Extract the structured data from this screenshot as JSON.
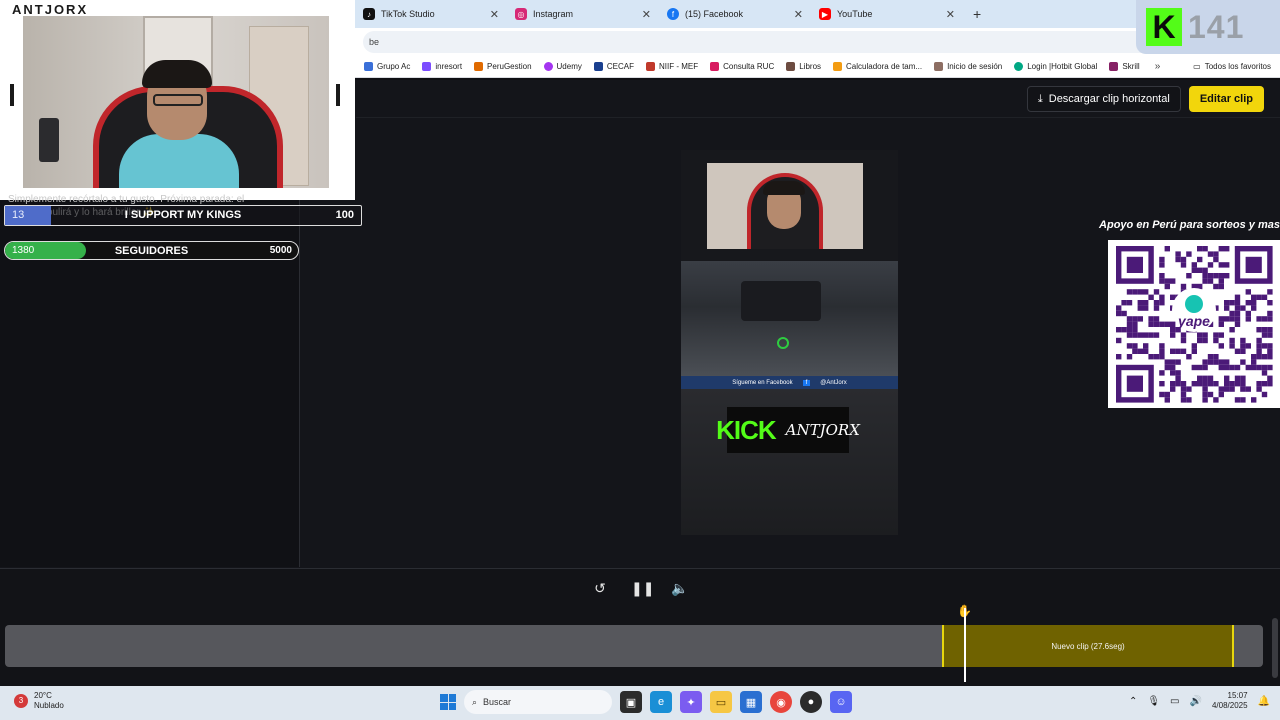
{
  "browser": {
    "tabs": [
      {
        "label": "TikTok Studio",
        "icon": "tiktok-icon",
        "color": "#111111"
      },
      {
        "label": "Instagram",
        "icon": "instagram-icon",
        "color": "#d62976"
      },
      {
        "label": "(15) Facebook",
        "icon": "facebook-icon",
        "color": "#1877f2"
      },
      {
        "label": "YouTube",
        "icon": "youtube-icon",
        "color": "#ff0000"
      }
    ],
    "address": "be",
    "bookmarks": [
      {
        "label": "Grupo Ac",
        "color": "#3a6fd8"
      },
      {
        "label": "inresort",
        "color": "#7c4dff"
      },
      {
        "label": "PeruGestion",
        "color": "#e06a00"
      },
      {
        "label": "Udemy",
        "color": "#a435f0"
      },
      {
        "label": "CECAF",
        "color": "#1a3f8f"
      },
      {
        "label": "NIIF - MEF",
        "color": "#c0392b"
      },
      {
        "label": "Consulta RUC",
        "color": "#d81b60"
      },
      {
        "label": "Libros",
        "color": "#6d4c41"
      },
      {
        "label": "Calculadora de tam...",
        "color": "#f39c12"
      },
      {
        "label": "Inicio de sesión",
        "color": "#8d6e63"
      },
      {
        "label": "Login |Hotbit Global",
        "color": "#00a884"
      },
      {
        "label": "Skrill",
        "color": "#862165"
      }
    ],
    "bookmarks_right": "Todos los favoritos"
  },
  "header": {
    "download_label": "Descargar clip horizontal",
    "edit_label": "Editar clip"
  },
  "overlay": {
    "channel": "ANTJORX",
    "chat_message": "Simplemente recórtalo a tu gusto. Próxima parada: el editor te pulirá y lo hará brillar ✨",
    "sub_goal": {
      "current": "13",
      "label": "I SUPPORT MY KINGS",
      "max": "100",
      "progress": 0.13
    },
    "follow_goal": {
      "current": "1380",
      "label": "SEGUIDORES",
      "max": "5000",
      "progress": 0.276
    },
    "viewer_count": "141"
  },
  "video": {
    "strip_text": "Sígueme en Facebook",
    "strip_handle": "@AntJorx",
    "kick_word": "KICK",
    "kick_name": "ANTJORX"
  },
  "qr": {
    "caption": "Apoyo en Perú para sorteos y mas",
    "brand": "yape"
  },
  "timeline": {
    "clip_label": "Nuevo clip (27.6seg)"
  },
  "taskbar": {
    "temperature": "20°C",
    "weather": "Nublado",
    "notifications": "3",
    "search_placeholder": "Buscar",
    "time": "15:07",
    "date": "4/08/2025"
  }
}
